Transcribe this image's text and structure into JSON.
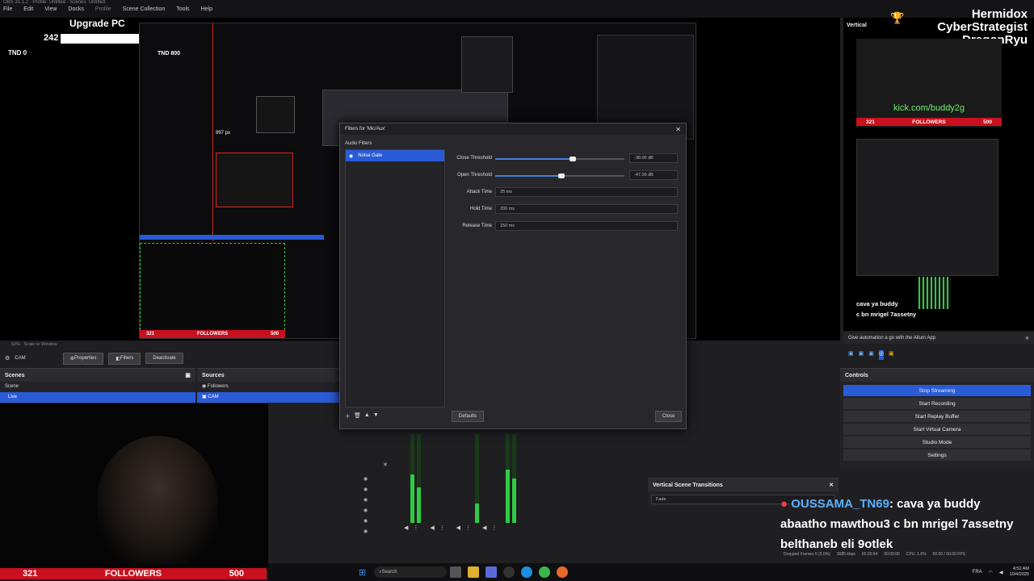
{
  "window": {
    "title": "OBS 31.1.2 - Profile: Untitled - Scenes: Untitled"
  },
  "menu": [
    "File",
    "Edit",
    "View",
    "Docks",
    "Profile",
    "Scene Collection",
    "Tools",
    "Help"
  ],
  "overlay_left": {
    "upgrade": "Upgrade PC",
    "count": "242",
    "tnd": "TND 0",
    "tnd_nested": "TND 800",
    "px": "997 px"
  },
  "preview_bottom": {
    "zoom": "53%",
    "scale": "Scale to Window"
  },
  "toolbar": {
    "source": "CAM",
    "properties": "Properties",
    "filters": "Filters",
    "deactivate": "Deactivate"
  },
  "scenes": {
    "title": "Scenes",
    "items": [
      "Scene",
      "Live"
    ]
  },
  "sources": {
    "title": "Sources",
    "items": [
      "Followers",
      "CAM"
    ]
  },
  "dialog": {
    "title": "Filters for 'Mic/Aux'",
    "section": "Audio Filters",
    "filter": "Noise Gate",
    "close_threshold_label": "Close Threshold",
    "close_threshold_value": "-38.00 dB",
    "close_threshold_fraction": 0.6,
    "open_threshold_label": "Open Threshold",
    "open_threshold_value": "-47.00 dB",
    "open_threshold_fraction": 0.51,
    "attack_label": "Attack Time",
    "attack_value": "25 ms",
    "hold_label": "Hold Time",
    "hold_value": "200 ms",
    "release_label": "Release Time",
    "release_value": "150 ms",
    "defaults": "Defaults",
    "close": "Close"
  },
  "vertical": {
    "label": "Vertical",
    "name1": "Hermidox",
    "name2": "CyberStrategist",
    "name3": "DragonRyu",
    "kick": "kick.com/buddy2g",
    "followers_current": "321",
    "followers_label": "FOLLOWERS",
    "followers_goal": "500",
    "nested_chat1": "cava ya buddy",
    "nested_chat2": "c bn mrigel 7assetny"
  },
  "aitum": {
    "text": "Give automation a go with the Aitum App"
  },
  "controls": {
    "title": "Controls",
    "buttons": [
      "Stop Streaming",
      "Start Recording",
      "Start Replay Buffer",
      "Start Virtual Camera",
      "Studio Mode",
      "Settings"
    ]
  },
  "transitions": {
    "title": "Vertical Scene Transitions",
    "value": "Fade"
  },
  "chat": {
    "user": "OUSSAMA_TN69",
    "msg1": ": cava ya buddy",
    "line2": "abaatho mawthou3 c bn mrigel 7assetny",
    "line3": "belthaneb eli 9otlek"
  },
  "status": {
    "dropped": "Dropped Frames 0 (0.0%)",
    "kbps": "3085 kbps",
    "time": "00:20:54",
    "rec": "00:00:00",
    "cpu": "CPU: 1.6%",
    "fps": "60.00 / 60.00 FPS"
  },
  "followers_bar": {
    "current": "321",
    "label": "FOLLOWERS",
    "goal": "500"
  },
  "taskbar": {
    "search": "Search",
    "lang": "FRA",
    "clock": "4:52 AM",
    "date": "10/4/2025"
  },
  "colors": {
    "accent": "#2a5bd7",
    "follower_red": "#c8101e",
    "meter_green": "#2ecc40"
  }
}
